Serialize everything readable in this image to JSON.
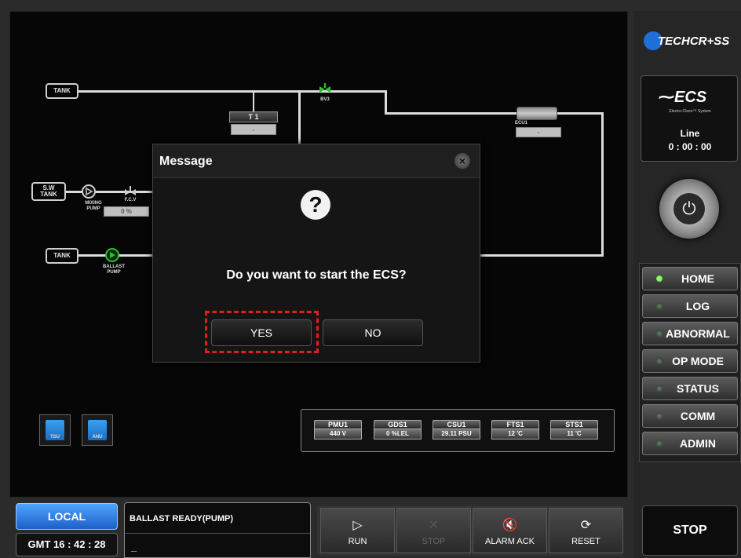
{
  "brand": {
    "logo_text": "TECHCR+SS"
  },
  "ecs_panel": {
    "title": "ECS",
    "subtitle": "Electro-Cleen™ System",
    "line_label": "Line",
    "line_time": "0 : 00 : 00"
  },
  "diagram": {
    "tank_top": "TANK",
    "sw_tank": "S.W\nTANK",
    "tank_bottom": "TANK",
    "bv3": "BV3",
    "t1_label": "T 1",
    "t1_value": "-",
    "ecu1_label": "ECU1",
    "ecu1_value": "-",
    "mixing_pump": "MIXING\nPUMP",
    "fcv_label": "F.C.V",
    "fcv_value": "0 %",
    "ballast_pump": "BALLAST\nPUMP",
    "tsu": "TSU",
    "anu": "ANU"
  },
  "sensors": [
    {
      "name": "PMU1",
      "value": "440 V"
    },
    {
      "name": "GDS1",
      "value": "0 %LEL"
    },
    {
      "name": "CSU1",
      "value": "29.11 PSU"
    },
    {
      "name": "FTS1",
      "value": "12 'C"
    },
    {
      "name": "STS1",
      "value": "11 'C"
    }
  ],
  "dialog": {
    "title": "Message",
    "icon": "question-icon",
    "question_glyph": "?",
    "message": "Do you want to start the ECS?",
    "yes_label": "YES",
    "no_label": "NO",
    "highlight_color": "#e0201a"
  },
  "menu": [
    {
      "label": "HOME",
      "active": true
    },
    {
      "label": "LOG",
      "active": false
    },
    {
      "label": "ABNORMAL",
      "active": false
    },
    {
      "label": "OP MODE",
      "active": false
    },
    {
      "label": "STATUS",
      "active": false
    },
    {
      "label": "COMM",
      "active": false
    },
    {
      "label": "ADMIN",
      "active": false
    }
  ],
  "bottom": {
    "mode": "LOCAL",
    "clock": "GMT 16 : 42 : 28",
    "status_text": "BALLAST READY(PUMP)",
    "status_cursor": "_",
    "run_label": "RUN",
    "stop_small_label": "STOP",
    "alarm_ack_label": "ALARM ACK",
    "reset_label": "RESET",
    "stop_label": "STOP"
  },
  "colors": {
    "accent_blue": "#1e6fd8",
    "pump_green": "#27c22a",
    "active_led": "#59d93a"
  }
}
